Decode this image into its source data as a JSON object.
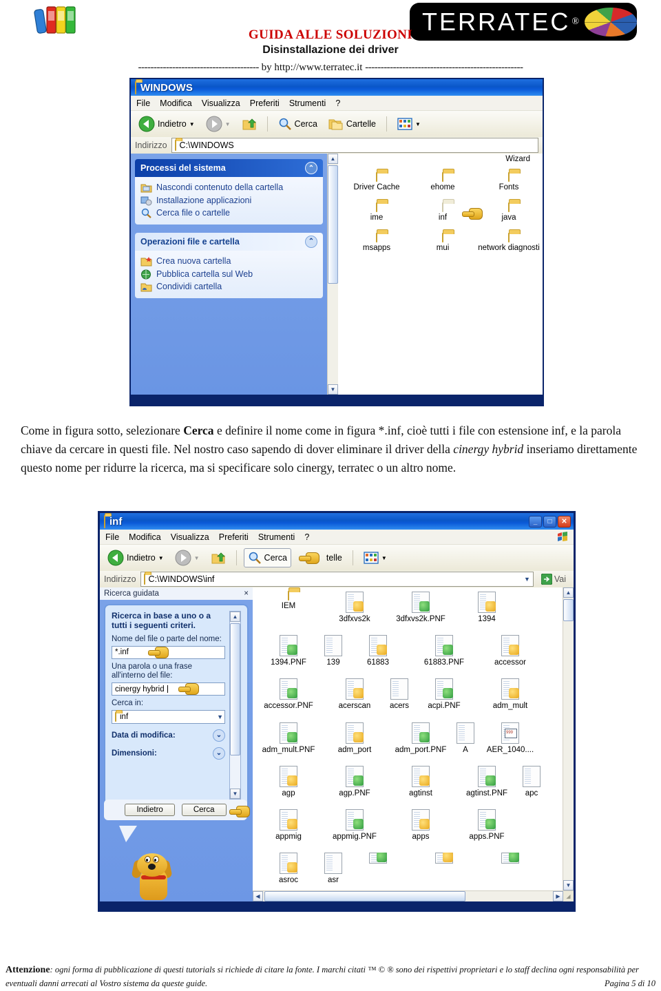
{
  "header": {
    "books_icon": "books-icon",
    "logo_text": "TERRATEC",
    "logo_reg": "®",
    "title": "GUIDA ALLE SOLUZIONI",
    "subtitle": "Disinstallazione dei driver",
    "by_prefix": "---------------------------------------",
    "by_text": "by  http://www.terratec.it",
    "by_suffix": "---------------------------------------------------"
  },
  "window1": {
    "title": "WINDOWS",
    "menu": [
      "File",
      "Modifica",
      "Visualizza",
      "Preferiti",
      "Strumenti",
      "?"
    ],
    "toolbar": {
      "back": "Indietro",
      "search": "Cerca",
      "folders": "Cartelle"
    },
    "address": {
      "label": "Indirizzo",
      "value": "C:\\WINDOWS"
    },
    "sidebar": {
      "block1": {
        "title": "Processi del sistema",
        "items": [
          "Nascondi contenuto della cartella",
          "Installazione applicazioni",
          "Cerca file o cartelle"
        ]
      },
      "block2": {
        "title": "Operazioni file e cartella",
        "items": [
          "Crea nuova cartella",
          "Pubblica cartella sul Web",
          "Condividi cartella"
        ]
      }
    },
    "files_clipped_top": "Wizard",
    "files": [
      {
        "name": "Driver Cache",
        "type": "folder"
      },
      {
        "name": "ehome",
        "type": "folder"
      },
      {
        "name": "Fonts",
        "type": "folder"
      },
      {
        "name": "ime",
        "type": "folder"
      },
      {
        "name": "inf",
        "type": "folder-selected"
      },
      {
        "name": "java",
        "type": "folder"
      },
      {
        "name": "msapps",
        "type": "folder"
      },
      {
        "name": "mui",
        "type": "folder"
      },
      {
        "name": "network diagnosti",
        "type": "folder"
      }
    ]
  },
  "paragraph": {
    "p1a": "Come in figura sotto, selezionare ",
    "p1b": "Cerca",
    "p1c": " e definire il nome come in figura *.inf, cioè tutti i file con estensione inf, e la parola chiave da cercare in questi file. Nel nostro caso sapendo di dover eliminare il driver della ",
    "p1d": "cinergy hybrid",
    "p1e": " inseriamo direttamente questo nome per ridurre la ricerca, ma si specificare solo cinergy, terratec o un altro nome."
  },
  "window2": {
    "title": "inf",
    "buttons": {
      "minimize": "_",
      "maximize": "□",
      "close": "✕"
    },
    "menu": [
      "File",
      "Modifica",
      "Visualizza",
      "Preferiti",
      "Strumenti",
      "?"
    ],
    "toolbar": {
      "back": "Indietro",
      "search": "Cerca",
      "folders": "telle"
    },
    "address": {
      "label": "Indirizzo",
      "value": "C:\\WINDOWS\\inf",
      "go": "Vai"
    },
    "search_pane": {
      "header": "Ricerca guidata",
      "close": "×",
      "title": "Ricerca in base a uno o a tutti i seguenti criteri.",
      "name_label": "Nome del file o parte del nome:",
      "name_value": "*.inf",
      "word_label": "Una parola o una frase all'interno del file:",
      "word_value": "cinergy hybrid",
      "searchin_label": "Cerca in:",
      "searchin_value": "inf",
      "date_label": "Data di modifica:",
      "size_label": "Dimensioni:",
      "back_button": "Indietro",
      "search_button": "Cerca"
    },
    "files": [
      {
        "name": "IEM",
        "type": "folder"
      },
      {
        "name": "3dfxvs2k",
        "type": "inf"
      },
      {
        "name": "3dfxvs2k.PNF",
        "type": "pnf"
      },
      {
        "name": "1394",
        "type": "inf"
      },
      {
        "name": "1394.PNF",
        "type": "pnf"
      },
      {
        "name": "139",
        "type": "clip"
      },
      {
        "name": "61883",
        "type": "inf"
      },
      {
        "name": "61883.PNF",
        "type": "pnf"
      },
      {
        "name": "accessor",
        "type": "inf"
      },
      {
        "name": "accessor.PNF",
        "type": "pnf"
      },
      {
        "name": "acerscan",
        "type": "inf"
      },
      {
        "name": "acers",
        "type": "clip"
      },
      {
        "name": "acpi.PNF",
        "type": "pnf"
      },
      {
        "name": "adm_mult",
        "type": "inf"
      },
      {
        "name": "adm_mult.PNF",
        "type": "pnf"
      },
      {
        "name": "adm_port",
        "type": "inf"
      },
      {
        "name": "adm_port.PNF",
        "type": "pnf"
      },
      {
        "name": "A",
        "type": "clip"
      },
      {
        "name": "AER_1040....",
        "type": "doc"
      },
      {
        "name": "agp",
        "type": "inf"
      },
      {
        "name": "agp.PNF",
        "type": "pnf"
      },
      {
        "name": "agtinst",
        "type": "inf"
      },
      {
        "name": "agtinst.PNF",
        "type": "pnf"
      },
      {
        "name": "apc",
        "type": "clip"
      },
      {
        "name": "appmig",
        "type": "inf"
      },
      {
        "name": "appmig.PNF",
        "type": "pnf"
      },
      {
        "name": "apps",
        "type": "inf"
      },
      {
        "name": "apps.PNF",
        "type": "pnf"
      },
      {
        "name": "asroc",
        "type": "inf"
      },
      {
        "name": "asr",
        "type": "clip"
      }
    ]
  },
  "footer": {
    "attention_label": "Attenzione",
    "text": ": ogni forma di pubblicazione di questi tutorials  si richiede di citare la fonte. I marchi citati ™ © ® sono dei rispettivi proprietari e  lo staff  declina ogni responsabilità per eventuali danni arrecati al Vostro sistema da queste guide.",
    "page": "Pagina 5 di 10"
  }
}
